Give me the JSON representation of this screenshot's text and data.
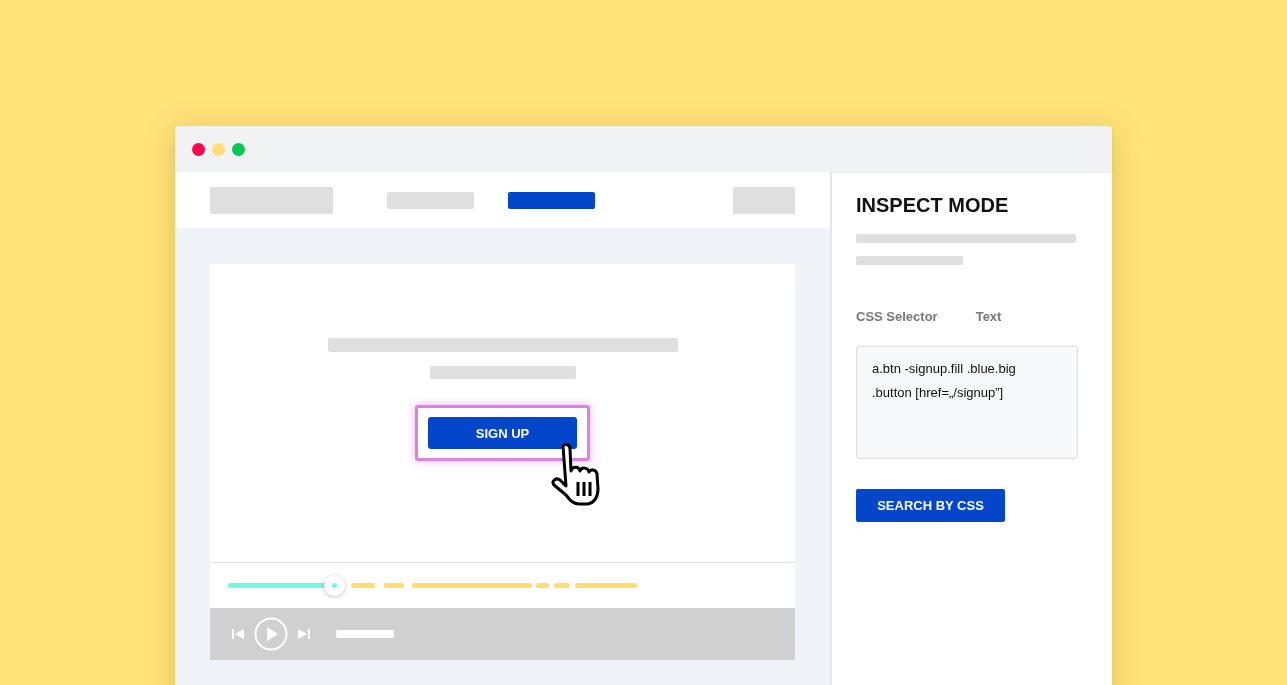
{
  "window": {
    "controls": [
      {
        "color": "#ff0550"
      },
      {
        "color": "#ffdd7a"
      },
      {
        "color": "#00c853"
      }
    ]
  },
  "page": {
    "nav": [
      {
        "selected": false
      },
      {
        "selected": true
      }
    ],
    "cta": {
      "label": "SIGN UP",
      "highlighted": true
    },
    "player": {
      "level": 0.26
    }
  },
  "inspector": {
    "title": "INSPECT MODE",
    "tabs": [
      "CSS Selector",
      "Text"
    ],
    "selector": [
      "a.btn -signup.fill .blue.big",
      ".button [href=„/signup”]"
    ],
    "action": "SEARCH BY CSS"
  }
}
